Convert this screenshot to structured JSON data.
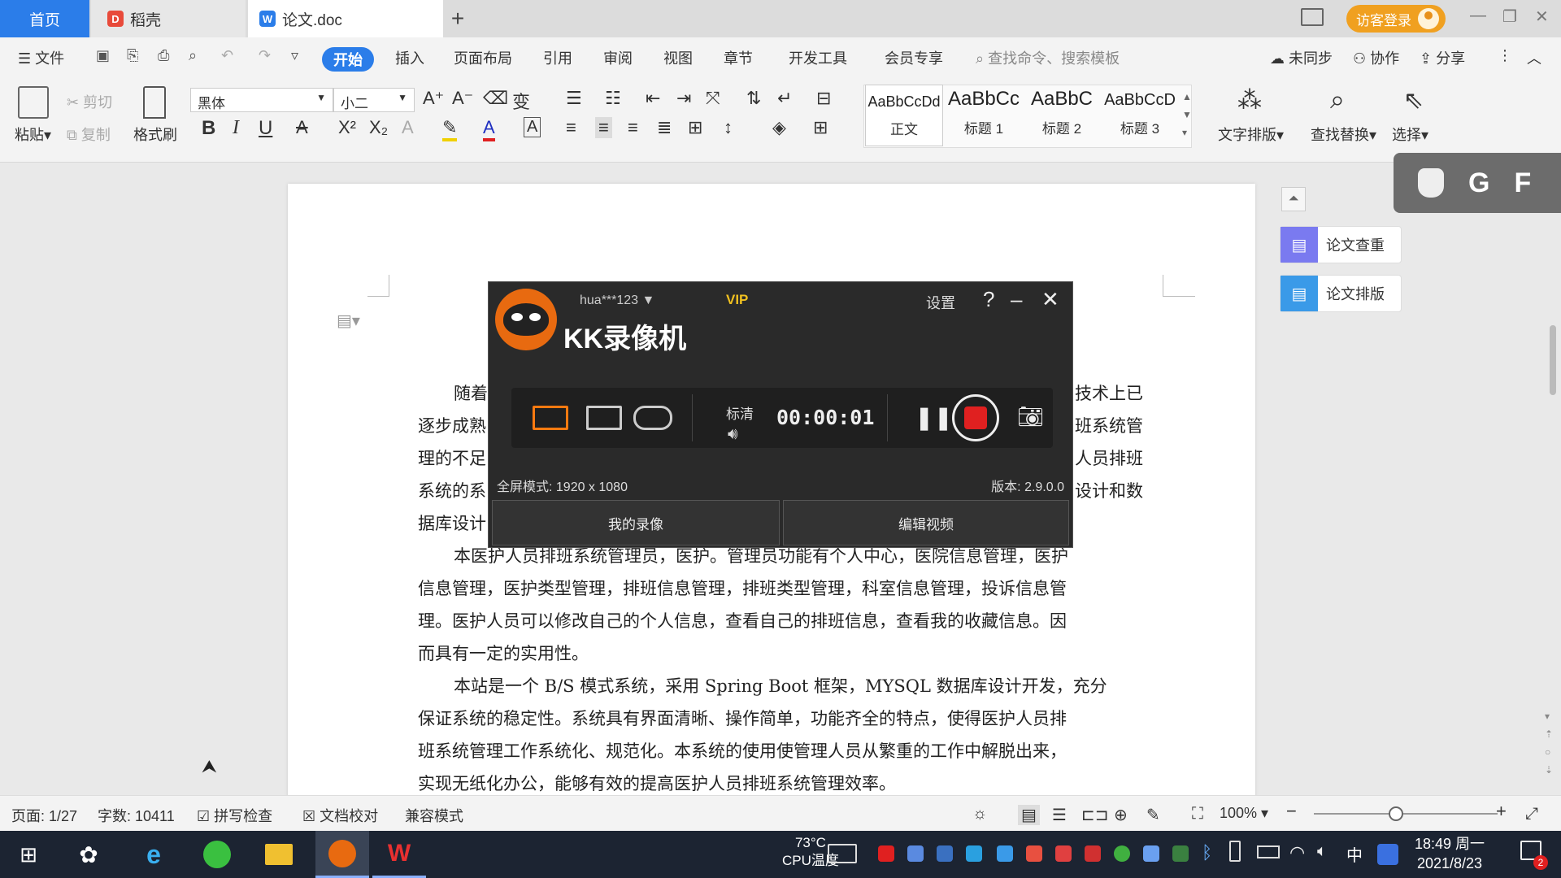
{
  "tabs": {
    "home": "首页",
    "daoke": "稻壳",
    "doc": "论文.doc",
    "add": "+"
  },
  "topbar": {
    "guest_login": "访客登录"
  },
  "menu": {
    "file": "文件",
    "start": "开始",
    "insert": "插入",
    "layout": "页面布局",
    "reference": "引用",
    "review": "审阅",
    "view": "视图",
    "chapter": "章节",
    "devtools": "开发工具",
    "member": "会员专享",
    "search_placeholder": "查找命令、搜索模板",
    "sync": "未同步",
    "collab": "协作",
    "share": "分享"
  },
  "ribbon": {
    "paste": "粘贴",
    "cut": "剪切",
    "copy": "复制",
    "format_painter": "格式刷",
    "font_name": "黑体",
    "font_size": "小二",
    "styles": [
      {
        "sample": "AaBbCcDd",
        "name": "正文"
      },
      {
        "sample": "AaBbCc",
        "name": "标题 1"
      },
      {
        "sample": "AaBbC",
        "name": "标题 2"
      },
      {
        "sample": "AaBbCcD",
        "name": "标题 3"
      }
    ],
    "text_layout": "文字排版",
    "find_replace": "查找替换",
    "select": "选择"
  },
  "side_panel": {
    "check": "论文查重",
    "layout": "论文排版"
  },
  "float_toolbar": {
    "g": "G",
    "f": "F"
  },
  "document": {
    "p1_lines": [
      "随着",
      "逐步成熟",
      "理的不足",
      "系统的系",
      "据库设计"
    ],
    "p1_right": [
      "技术上已",
      "班系统管",
      "人员排班",
      "设计和数"
    ],
    "p2_lines": [
      "本医护人员排班系统管理员，医护。管理员功能有个人中心，医院信息管理，医护",
      "信息管理，医护类型管理，排班信息管理，排班类型管理，科室信息管理，投诉信息管",
      "理。医护人员可以修改自己的个人信息，查看自己的排班信息，查看我的收藏信息。因",
      "而具有一定的实用性。"
    ],
    "p3_lines": [
      "本站是一个 B/S 模式系统，采用 Spring Boot 框架，MYSQL 数据库设计开发，充分",
      "保证系统的稳定性。系统具有界面清晰、操作简单，功能齐全的特点，使得医护人员排",
      "班系统管理工作系统化、规范化。本系统的使用使管理人员从繁重的工作中解脱出来，",
      "实现无纸化办公，能够有效的提高医护人员排班系统管理效率。"
    ]
  },
  "kk": {
    "user": "hua***123",
    "vip": "VIP",
    "settings": "设置",
    "help": "?",
    "title": "KK录像机",
    "quality": "标清",
    "timer": "00:00:01",
    "mode_info": "全屏模式: 1920 x 1080",
    "version": "版本: 2.9.0.0",
    "my_recordings": "我的录像",
    "edit_video": "编辑视频"
  },
  "status": {
    "page": "页面: 1/27",
    "words": "字数: 10411",
    "spell": "拼写检查",
    "doc_check": "文档校对",
    "compat": "兼容模式",
    "zoom": "100%"
  },
  "taskbar": {
    "temp": "73°C",
    "cpu": "CPU温度",
    "ime": "中",
    "time": "18:49 周一",
    "date": "2021/8/23",
    "notif_count": "2"
  },
  "colors": {
    "accent": "#2b7de9",
    "record_red": "#e02020",
    "kk_orange": "#e86a10",
    "guest_orange": "#f0a020"
  }
}
